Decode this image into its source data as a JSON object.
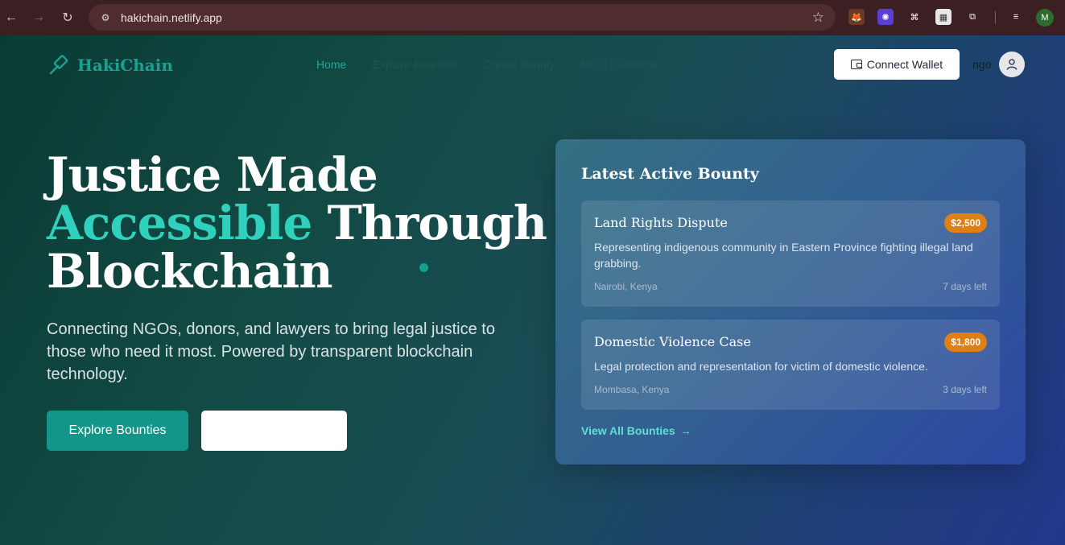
{
  "browser": {
    "url": "hakichain.netlify.app",
    "profile_initial": "M"
  },
  "site": {
    "brand": "HakiChain",
    "nav": [
      {
        "label": "Home",
        "active": true
      },
      {
        "label": "Explore Bounties",
        "active": false
      },
      {
        "label": "Create Bounty",
        "active": false
      },
      {
        "label": "NGO Dashboard",
        "active": false
      }
    ],
    "connect_wallet": "Connect Wallet",
    "user_role": "ngo"
  },
  "hero": {
    "line1": "Justice Made",
    "accent": "Accessible",
    "line2_rest": " Through",
    "line3": "Blockchain",
    "subtext": "Connecting NGOs, donors, and lawyers to bring legal justice to those who need it most. Powered by transparent blockchain technology.",
    "primary_button": "Explore Bounties",
    "secondary_button": ""
  },
  "bounty_panel": {
    "title": "Latest Active Bounty",
    "bounties": [
      {
        "title": "Land Rights Dispute",
        "amount": "$2,500",
        "description": "Representing indigenous community in Eastern Province fighting illegal land grabbing.",
        "location": "Nairobi, Kenya",
        "due": "7 days left"
      },
      {
        "title": "Domestic Violence Case",
        "amount": "$1,800",
        "description": "Legal protection and representation for victim of domestic violence.",
        "location": "Mombasa, Kenya",
        "due": "3 days left"
      }
    ],
    "view_all": "View All Bounties"
  },
  "colors": {
    "accent_teal": "#2fd1bd",
    "amount_badge": "#e07f14",
    "primary_button": "#13968a"
  }
}
